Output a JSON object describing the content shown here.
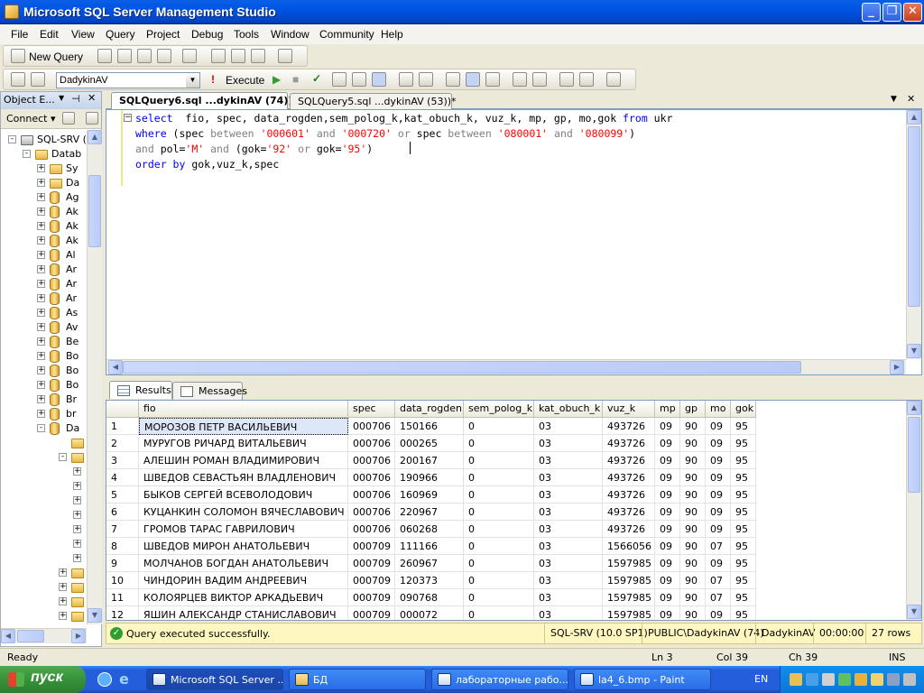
{
  "window": {
    "title": "Microsoft SQL Server Management Studio"
  },
  "menu": [
    "File",
    "Edit",
    "View",
    "Query",
    "Project",
    "Debug",
    "Tools",
    "Window",
    "Community",
    "Help"
  ],
  "toolbar": {
    "new_query": "New Query",
    "database": "DadykinAV",
    "execute": "Execute"
  },
  "object_explorer": {
    "title": "Object E...",
    "connect": "Connect ▾",
    "tree": [
      {
        "label": "SQL-SRV (",
        "level": 0,
        "expander": "-",
        "icon": "server"
      },
      {
        "label": "Datab",
        "level": 1,
        "expander": "-",
        "icon": "folder"
      },
      {
        "label": "Sy",
        "level": 2,
        "expander": "+",
        "icon": "folder"
      },
      {
        "label": "Da",
        "level": 2,
        "expander": "+",
        "icon": "folder"
      },
      {
        "label": "Ag",
        "level": 2,
        "expander": "+",
        "icon": "db"
      },
      {
        "label": "Ak",
        "level": 2,
        "expander": "+",
        "icon": "db"
      },
      {
        "label": "Ak",
        "level": 2,
        "expander": "+",
        "icon": "db"
      },
      {
        "label": "Ak",
        "level": 2,
        "expander": "+",
        "icon": "db"
      },
      {
        "label": "Al",
        "level": 2,
        "expander": "+",
        "icon": "db"
      },
      {
        "label": "Ar",
        "level": 2,
        "expander": "+",
        "icon": "db"
      },
      {
        "label": "Ar",
        "level": 2,
        "expander": "+",
        "icon": "db"
      },
      {
        "label": "Ar",
        "level": 2,
        "expander": "+",
        "icon": "db"
      },
      {
        "label": "As",
        "level": 2,
        "expander": "+",
        "icon": "db"
      },
      {
        "label": "Av",
        "level": 2,
        "expander": "+",
        "icon": "db"
      },
      {
        "label": "Be",
        "level": 2,
        "expander": "+",
        "icon": "db"
      },
      {
        "label": "Bo",
        "level": 2,
        "expander": "+",
        "icon": "db"
      },
      {
        "label": "Bo",
        "level": 2,
        "expander": "+",
        "icon": "db"
      },
      {
        "label": "Bo",
        "level": 2,
        "expander": "+",
        "icon": "db"
      },
      {
        "label": "Br",
        "level": 2,
        "expander": "+",
        "icon": "db"
      },
      {
        "label": "br",
        "level": 2,
        "expander": "+",
        "icon": "db"
      },
      {
        "label": "Da",
        "level": 2,
        "expander": "-",
        "icon": "db"
      },
      {
        "label": "",
        "level": 3,
        "expander": "",
        "icon": "folder"
      },
      {
        "label": "",
        "level": 3,
        "expander": "-",
        "icon": "folder"
      },
      {
        "label": "",
        "level": 4,
        "expander": "+",
        "icon": ""
      },
      {
        "label": "",
        "level": 4,
        "expander": "+",
        "icon": ""
      },
      {
        "label": "",
        "level": 4,
        "expander": "+",
        "icon": ""
      },
      {
        "label": "",
        "level": 4,
        "expander": "+",
        "icon": ""
      },
      {
        "label": "",
        "level": 4,
        "expander": "+",
        "icon": ""
      },
      {
        "label": "",
        "level": 4,
        "expander": "+",
        "icon": ""
      },
      {
        "label": "",
        "level": 4,
        "expander": "+",
        "icon": ""
      },
      {
        "label": "",
        "level": 3,
        "expander": "+",
        "icon": "folder"
      },
      {
        "label": "",
        "level": 3,
        "expander": "+",
        "icon": "folder"
      },
      {
        "label": "",
        "level": 3,
        "expander": "+",
        "icon": "folder"
      },
      {
        "label": "",
        "level": 3,
        "expander": "+",
        "icon": "folder"
      }
    ]
  },
  "tabs": [
    {
      "label": "SQLQuery6.sql ...dykinAV (74))*",
      "active": true
    },
    {
      "label": "SQLQuery5.sql ...dykinAV (53))*",
      "active": false
    }
  ],
  "editor": {
    "lines": [
      [
        [
          "kw",
          "select"
        ],
        [
          "",
          "  fio, spec, data_rogden,sem_polog_k,kat_obuch_k, vuz_k, mp, gp, mo,gok "
        ],
        [
          "kw",
          "from"
        ],
        [
          "",
          " ukr"
        ]
      ],
      [
        [
          "kw",
          "where"
        ],
        [
          "",
          " ("
        ],
        [
          "",
          "spec "
        ],
        [
          "op",
          "between"
        ],
        [
          "",
          " "
        ],
        [
          "str",
          "'000601'"
        ],
        [
          "",
          " "
        ],
        [
          "op",
          "and"
        ],
        [
          "",
          " "
        ],
        [
          "str",
          "'000720'"
        ],
        [
          "",
          " "
        ],
        [
          "op",
          "or"
        ],
        [
          "",
          " spec "
        ],
        [
          "op",
          "between"
        ],
        [
          "",
          " "
        ],
        [
          "str",
          "'080001'"
        ],
        [
          "",
          " "
        ],
        [
          "op",
          "and"
        ],
        [
          "",
          " "
        ],
        [
          "str",
          "'080099'"
        ],
        [
          "",
          ")"
        ]
      ],
      [
        [
          "op",
          "and"
        ],
        [
          "",
          " pol="
        ],
        [
          "str",
          "'M'"
        ],
        [
          "",
          " "
        ],
        [
          "op",
          "and"
        ],
        [
          "",
          " (gok="
        ],
        [
          "str",
          "'92'"
        ],
        [
          "",
          " "
        ],
        [
          "op",
          "or"
        ],
        [
          "",
          " gok="
        ],
        [
          "str",
          "'95'"
        ],
        [
          "",
          ")"
        ]
      ],
      [
        [
          "kw",
          "order by"
        ],
        [
          "",
          " gok,vuz_k,spec"
        ]
      ]
    ]
  },
  "results_tabs": [
    "Results",
    "Messages"
  ],
  "grid": {
    "columns": [
      "fio",
      "spec",
      "data_rogden",
      "sem_polog_k",
      "kat_obuch_k",
      "vuz_k",
      "mp",
      "gp",
      "mo",
      "gok"
    ],
    "rows": [
      [
        "1",
        "МОРОЗОВ ПЕТР ВАСИЛЬЕВИЧ",
        "000706",
        "150166",
        "0",
        "03",
        "493726",
        "09",
        "90",
        "09",
        "95"
      ],
      [
        "2",
        "МУРУГОВ РИЧАРД ВИТАЛЬЕВИЧ",
        "000706",
        "000265",
        "0",
        "03",
        "493726",
        "09",
        "90",
        "09",
        "95"
      ],
      [
        "3",
        "АЛЕШИН РОМАН ВЛАДИМИРОВИЧ",
        "000706",
        "200167",
        "0",
        "03",
        "493726",
        "09",
        "90",
        "09",
        "95"
      ],
      [
        "4",
        "ШВЕДОВ СЕВАСТЬЯН ВЛАДЛЕНОВИЧ",
        "000706",
        "190966",
        "0",
        "03",
        "493726",
        "09",
        "90",
        "09",
        "95"
      ],
      [
        "5",
        "БЫКОВ СЕРГЕЙ ВСЕВОЛОДОВИЧ",
        "000706",
        "160969",
        "0",
        "03",
        "493726",
        "09",
        "90",
        "09",
        "95"
      ],
      [
        "6",
        "КУЦАНКИН СОЛОМОН ВЯЧЕСЛАВОВИЧ",
        "000706",
        "220967",
        "0",
        "03",
        "493726",
        "09",
        "90",
        "09",
        "95"
      ],
      [
        "7",
        "ГРОМОВ ТАРАС ГАВРИЛОВИЧ",
        "000706",
        "060268",
        "0",
        "03",
        "493726",
        "09",
        "90",
        "09",
        "95"
      ],
      [
        "8",
        "ШВЕДОВ МИРОН АНАТОЛЬЕВИЧ",
        "000709",
        "111166",
        "0",
        "03",
        "1566056",
        "09",
        "90",
        "07",
        "95"
      ],
      [
        "9",
        "МОЛЧАНОВ БОГДАН АНАТОЛЬЕВИЧ",
        "000709",
        "260967",
        "0",
        "03",
        "1597985",
        "09",
        "90",
        "09",
        "95"
      ],
      [
        "10",
        "ЧИНДОРИН ВАДИМ АНДРЕЕВИЧ",
        "000709",
        "120373",
        "0",
        "03",
        "1597985",
        "09",
        "90",
        "07",
        "95"
      ],
      [
        "11",
        "КОЛОЯРЦЕВ ВИКТОР АРКАДЬЕВИЧ",
        "000709",
        "090768",
        "0",
        "03",
        "1597985",
        "09",
        "90",
        "07",
        "95"
      ],
      [
        "12",
        "ЯШИН АЛЕКСАНДР СТАНИСЛАВОВИЧ",
        "000709",
        "000072",
        "0",
        "03",
        "1597985",
        "09",
        "90",
        "09",
        "95"
      ]
    ]
  },
  "exec_status": {
    "message": "Query executed successfully.",
    "server": "SQL-SRV (10.0 SP1)",
    "user": "PUBLIC\\DadykinAV (74)",
    "database": "DadykinAV",
    "elapsed": "00:00:00",
    "rows": "27 rows"
  },
  "statusbar": {
    "ready": "Ready",
    "ln": "Ln 3",
    "col": "Col 39",
    "ch": "Ch 39",
    "ins": "INS"
  },
  "taskbar": {
    "start": "пуск",
    "tasks": [
      {
        "label": "Microsoft SQL Server ...",
        "active": true
      },
      {
        "label": "БД",
        "active": false
      },
      {
        "label": "лабораторные рабо...",
        "active": false
      },
      {
        "label": "la4_6.bmp - Paint",
        "active": false
      }
    ],
    "lang": "EN"
  },
  "colors": {
    "keyword": "#0000ff",
    "string": "#ff0000",
    "operator": "#808080",
    "title_bar": "#0054e3",
    "exec_bar": "#fff7c0"
  }
}
